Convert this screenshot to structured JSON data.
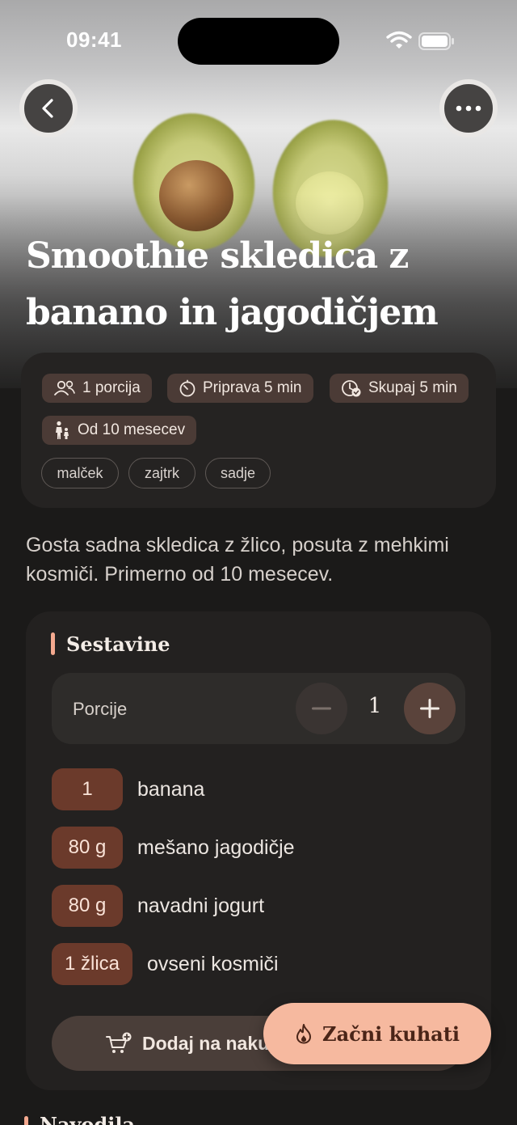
{
  "status_bar": {
    "time": "09:41"
  },
  "header": {
    "back_icon": "chevron-left-icon",
    "more_icon": "ellipsis-icon",
    "title": "Smoothie skledica z banano in jagodičjem"
  },
  "meta": {
    "chips": [
      {
        "icon": "people-icon",
        "label": "1 porcija"
      },
      {
        "icon": "timer-icon",
        "label": "Priprava 5 min"
      },
      {
        "icon": "clock-check-icon",
        "label": "Skupaj 5 min"
      },
      {
        "icon": "child-icon",
        "label": "Od 10 mesecev"
      }
    ],
    "tags": [
      "malček",
      "zajtrk",
      "sadje"
    ]
  },
  "description": "Gosta sadna skledica z žlico, posuta z mehkimi kosmiči. Primerno od 10 mesecev.",
  "ingredients": {
    "title": "Sestavine",
    "portions_label": "Porcije",
    "portions_value": "1",
    "items": [
      {
        "qty": "1",
        "name": "banana"
      },
      {
        "qty": "80 g",
        "name": "mešano jagodičje"
      },
      {
        "qty": "80 g",
        "name": "navadni jogurt"
      },
      {
        "qty": "1 žlica",
        "name": "ovseni kosmiči"
      }
    ],
    "add_to_cart_label": "Dodaj na nakupovalni seznam"
  },
  "start_cooking_label": "Začni kuhati",
  "next_section_title": "Navodila",
  "colors": {
    "accent": "#f6b99f",
    "chip_bg": "#4b3b36",
    "qty_bg": "#6b3a2b",
    "background": "#1b1a19"
  }
}
